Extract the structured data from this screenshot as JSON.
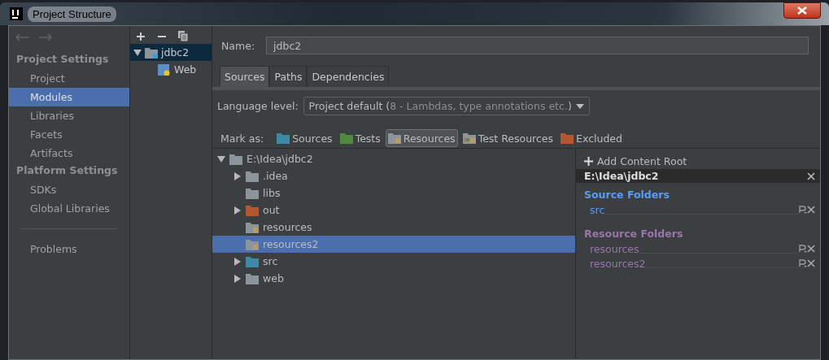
{
  "window": {
    "title": "Project Structure"
  },
  "sidebar": {
    "sections": [
      {
        "heading": "Project Settings",
        "items": [
          {
            "label": "Project",
            "selected": false
          },
          {
            "label": "Modules",
            "selected": true
          },
          {
            "label": "Libraries",
            "selected": false
          },
          {
            "label": "Facets",
            "selected": false
          },
          {
            "label": "Artifacts",
            "selected": false
          }
        ]
      },
      {
        "heading": "Platform Settings",
        "items": [
          {
            "label": "SDKs",
            "selected": false
          },
          {
            "label": "Global Libraries",
            "selected": false
          }
        ]
      }
    ],
    "footer_items": [
      {
        "label": "Problems",
        "selected": false
      }
    ]
  },
  "module_tree": {
    "items": [
      {
        "label": "jdbc2",
        "kind": "module",
        "expanded": true,
        "selected": true,
        "children": [
          {
            "label": "Web",
            "kind": "web",
            "selected": false
          }
        ]
      }
    ]
  },
  "name_field": {
    "label": "Name:",
    "value": "jdbc2"
  },
  "tabs": [
    {
      "label": "Sources",
      "selected": true
    },
    {
      "label": "Paths",
      "selected": false
    },
    {
      "label": "Dependencies",
      "selected": false
    }
  ],
  "language_level": {
    "label": "Language level:",
    "value": "Project default (",
    "hint": "8 - Lambdas, type annotations etc.",
    "value_end": ")"
  },
  "mark_as": {
    "label": "Mark as:",
    "options": [
      {
        "label": "Sources",
        "kind": "source",
        "selected": false
      },
      {
        "label": "Tests",
        "kind": "test",
        "selected": false
      },
      {
        "label": "Resources",
        "kind": "resource",
        "selected": true
      },
      {
        "label": "Test Resources",
        "kind": "test_resource",
        "selected": false
      },
      {
        "label": "Excluded",
        "kind": "excluded",
        "selected": false
      }
    ]
  },
  "file_tree": {
    "label": "E:\\Idea\\jdbc2",
    "kind": "plain",
    "expandable": true,
    "expanded": true,
    "selected": false,
    "children": [
      {
        "label": ".idea",
        "kind": "plain",
        "expandable": true,
        "expanded": false,
        "selected": false
      },
      {
        "label": "libs",
        "kind": "plain",
        "expandable": false,
        "expanded": false,
        "selected": false
      },
      {
        "label": "out",
        "kind": "excluded",
        "expandable": true,
        "expanded": false,
        "selected": false
      },
      {
        "label": "resources",
        "kind": "resource",
        "expandable": false,
        "expanded": false,
        "selected": false
      },
      {
        "label": "resources2",
        "kind": "resource",
        "expandable": false,
        "expanded": false,
        "selected": true
      },
      {
        "label": "src",
        "kind": "source",
        "expandable": true,
        "expanded": false,
        "selected": false
      },
      {
        "label": "web",
        "kind": "plain",
        "expandable": true,
        "expanded": false,
        "selected": false
      }
    ]
  },
  "content_roots": {
    "add_label": "Add Content Root",
    "root": "E:\\Idea\\jdbc2",
    "sections": [
      {
        "heading": "Source Folders",
        "kind": "source",
        "folders": [
          "src"
        ]
      },
      {
        "heading": "Resource Folders",
        "kind": "resource",
        "folders": [
          "resources",
          "resources2"
        ]
      }
    ]
  }
}
